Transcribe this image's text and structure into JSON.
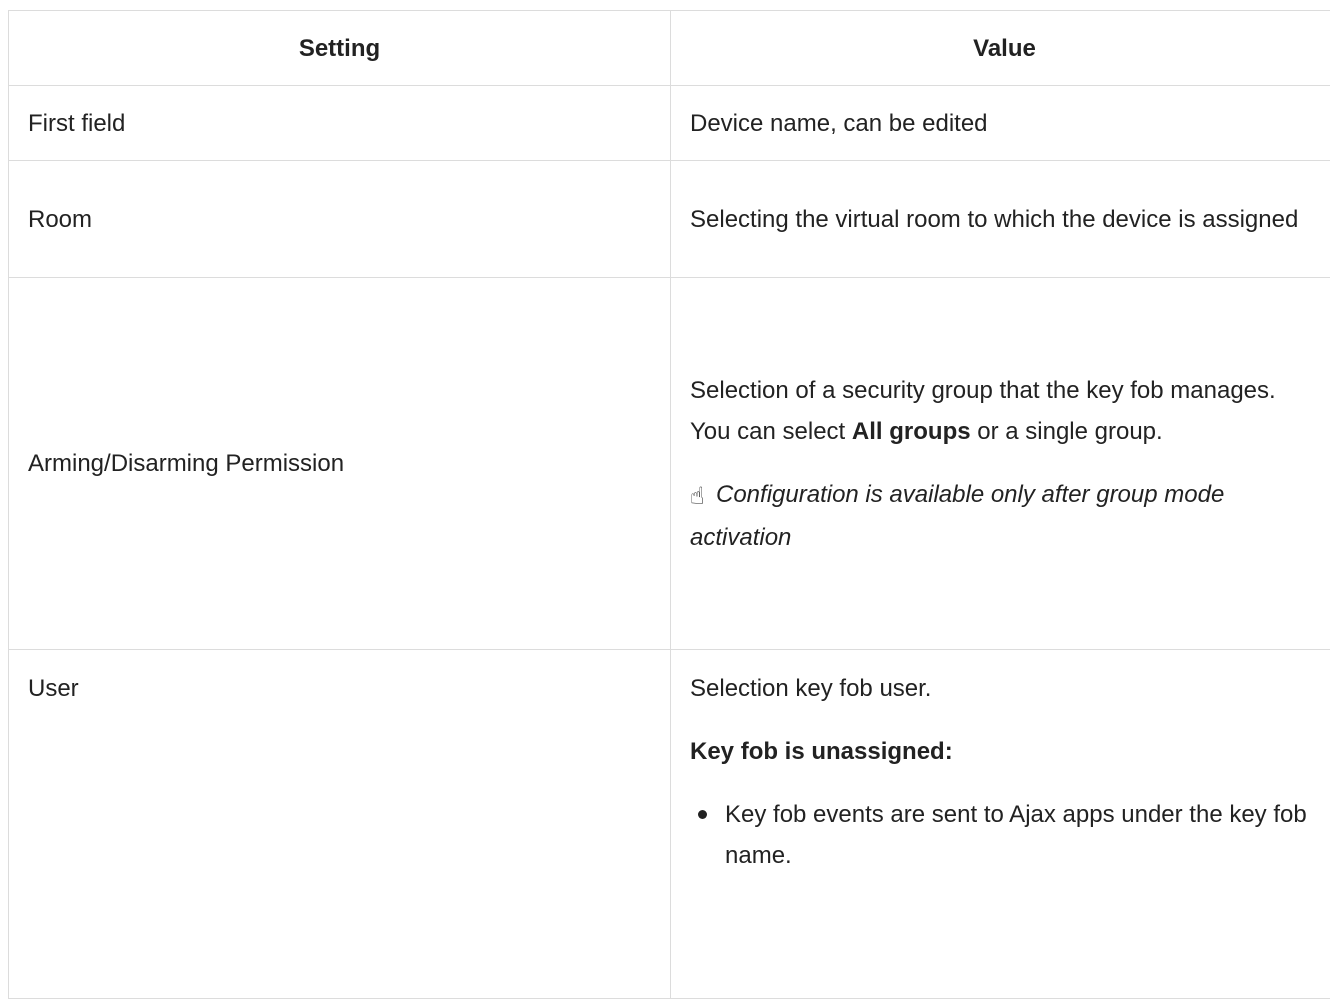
{
  "table": {
    "headers": {
      "setting": "Setting",
      "value": "Value"
    },
    "rows": [
      {
        "setting": "First field",
        "value": "Device name, can be edited"
      },
      {
        "setting": "Room",
        "value": "Selecting the virtual room to which the device is assigned"
      },
      {
        "setting": "Arming/Disarming Permission",
        "value_before": "Selection of a security group that the key fob manages. You can select ",
        "value_bold": "All groups",
        "value_after": " or a single group.",
        "note_icon": "pointing-hand-icon",
        "note_glyph": "☝",
        "note": "Configuration is available only after group mode activation"
      },
      {
        "setting": "User",
        "value": "Selection key fob user.",
        "subheading": "Key fob is unassigned:",
        "bullets": [
          "Key fob events are sent to Ajax apps under the key fob name."
        ]
      }
    ]
  }
}
